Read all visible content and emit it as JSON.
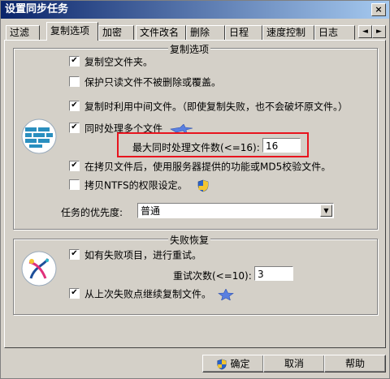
{
  "window": {
    "title": "设置同步任务",
    "close_glyph": "×"
  },
  "tabs": [
    {
      "label": "过滤"
    },
    {
      "label": "复制选项"
    },
    {
      "label": "加密"
    },
    {
      "label": "文件改名"
    },
    {
      "label": "删除"
    },
    {
      "label": "日程"
    },
    {
      "label": "速度控制"
    },
    {
      "label": "日志"
    }
  ],
  "tab_scroll": {
    "left": "◄",
    "right": "►"
  },
  "copy_options": {
    "title": "复制选项",
    "copy_empty_folders": {
      "label": "复制空文件夹。",
      "checked": true
    },
    "protect_readonly": {
      "label": "保护只读文件不被删除或覆盖。",
      "checked": false
    },
    "use_temp_file": {
      "label": "复制时利用中间文件。（即使复制失败，也不会破坏原文件。）",
      "checked": true
    },
    "parallel": {
      "label": "同时处理多个文件",
      "checked": true
    },
    "max_files_label": "最大同时处理文件数(<=16):",
    "max_files_value": "16",
    "verify_md5": {
      "label": "在拷贝文件后，使用服务器提供的功能或MD5校验文件。",
      "checked": true
    },
    "copy_ntfs": {
      "label": "拷贝NTFS的权限设定。",
      "checked": false
    },
    "priority_label": "任务的优先度:",
    "priority_value": "普通"
  },
  "failure_recovery": {
    "title": "失败恢复",
    "retry": {
      "label": "如有失败项目，进行重试。",
      "checked": true
    },
    "retry_count_label": "重试次数(<=10):",
    "retry_count_value": "3",
    "resume": {
      "label": "从上次失败点继续复制文件。",
      "checked": true
    }
  },
  "buttons": {
    "ok": "确定",
    "cancel": "取消",
    "help": "帮助"
  },
  "check_glyph": "✔",
  "dropdown_glyph": "▼",
  "colors": {
    "highlight": "#e8141e",
    "title_bar": "#0a246a",
    "icon_blue": "#2a8fbf"
  }
}
